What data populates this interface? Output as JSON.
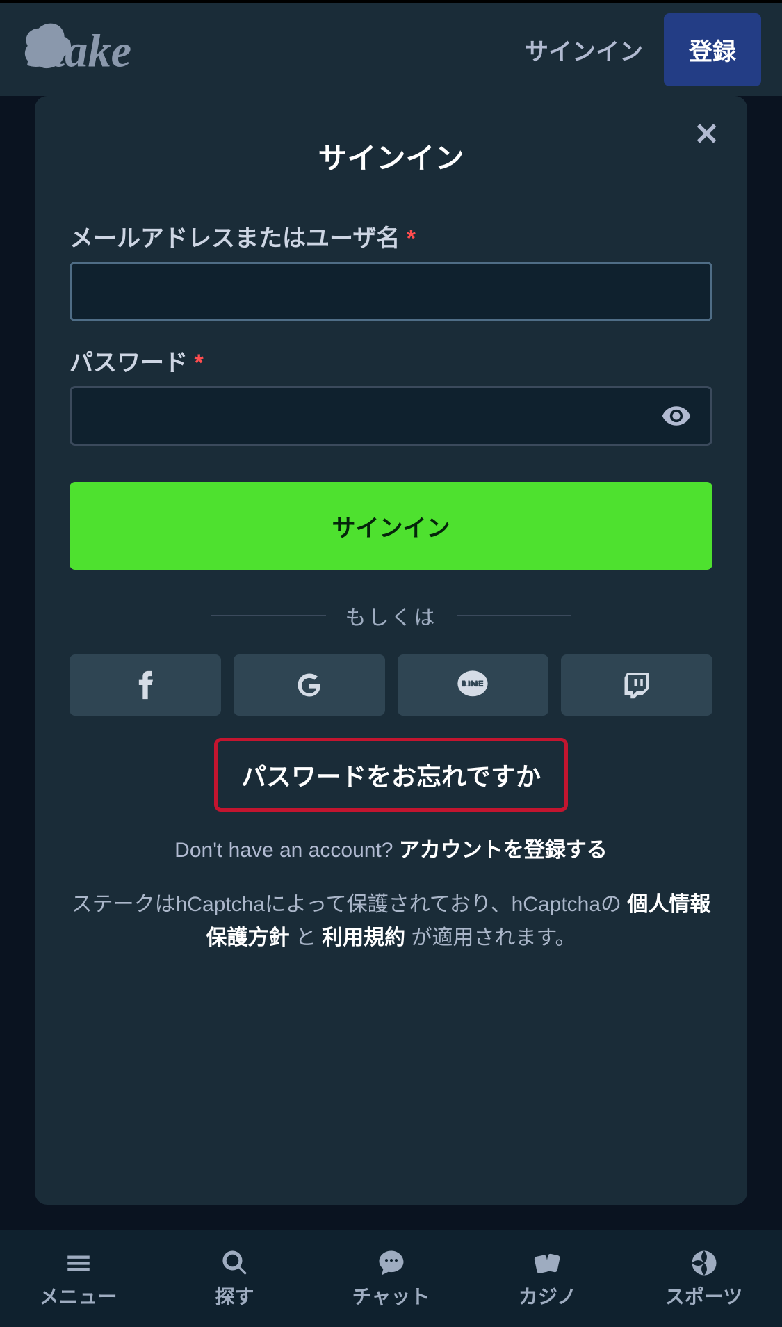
{
  "header": {
    "signin_link": "サインイン",
    "register_button": "登録"
  },
  "modal": {
    "title": "サインイン",
    "email_label": "メールアドレスまたはユーザ名",
    "password_label": "パスワード",
    "required_mark": "*",
    "signin_button": "サインイン",
    "divider_text": "もしくは",
    "forgot_password": "パスワードをお忘れですか",
    "no_account_q": "Don't have an account?",
    "register_link": "アカウントを登録する",
    "legal_1": "ステークはhCaptchaによって保護されており、hCaptchaの",
    "legal_privacy": "個人情報保護方針",
    "legal_and": "と",
    "legal_tos": "利用規約",
    "legal_2": "が適用されます。"
  },
  "bottom_nav": {
    "menu": "メニュー",
    "search": "探す",
    "chat": "チャット",
    "casino": "カジノ",
    "sports": "スポーツ"
  }
}
